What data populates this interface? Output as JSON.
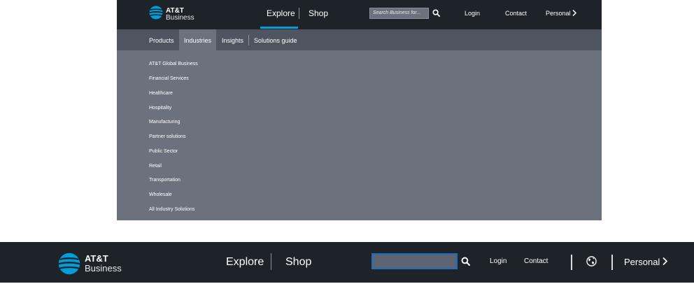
{
  "top": {
    "brand": {
      "line1": "AT&T",
      "line2": "Business"
    },
    "nav": {
      "explore": "Explore",
      "shop": "Shop"
    },
    "search": {
      "placeholder": "Search Business for..."
    },
    "links": {
      "login": "Login",
      "contact": "Contact",
      "personal": "Personal"
    },
    "subnav": {
      "items": [
        "Products",
        "Industries",
        "Insights",
        "Solutions guide"
      ],
      "active": "Industries"
    },
    "menu": [
      "AT&T Global Business",
      "Financial Services",
      "Healthcare",
      "Hospitality",
      "Manufacturing",
      "Partner solutions",
      "Public Sector",
      "Retail",
      "Transportation",
      "Wholesale",
      "All Industry Solutions"
    ]
  },
  "bottom": {
    "brand": {
      "line1": "AT&T",
      "line2": "Business"
    },
    "nav": {
      "explore": "Explore",
      "shop": "Shop"
    },
    "search": {
      "value": ""
    },
    "links": {
      "login": "Login",
      "contact": "Contact",
      "personal": "Personal"
    }
  },
  "icons": [
    "att-globe-logo",
    "search-icon",
    "chevron-right-icon",
    "globe-icon"
  ],
  "colors": {
    "nav_bg": "#1d2329",
    "subnav_bg": "#4f5560",
    "menu_bg": "#6c717e",
    "accent": "#009fdb",
    "search_focus": "#1f6fbf"
  }
}
